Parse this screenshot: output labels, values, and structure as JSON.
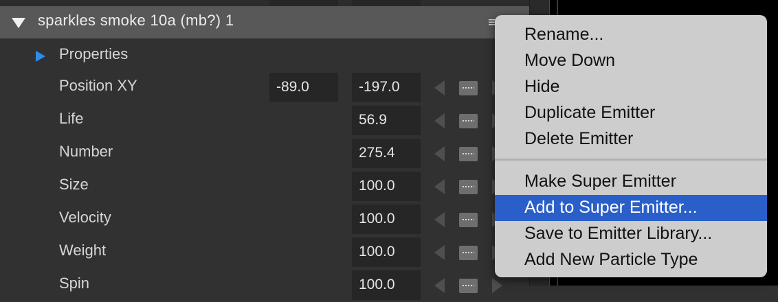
{
  "panel": {
    "title": "sparkles smoke 10a (mb?) 1",
    "menu_glyph": "≡",
    "section_label": "Properties"
  },
  "rows": [
    {
      "label": "Position XY",
      "x": "-89.0",
      "y": "-197.0"
    },
    {
      "label": "Life",
      "y": "56.9"
    },
    {
      "label": "Number",
      "y": "275.4"
    },
    {
      "label": "Size",
      "y": "100.0"
    },
    {
      "label": "Velocity",
      "y": "100.0"
    },
    {
      "label": "Weight",
      "y": "100.0"
    },
    {
      "label": "Spin",
      "y": "100.0"
    }
  ],
  "context_menu": {
    "items": [
      "Rename...",
      "Move Down",
      "Hide",
      "Duplicate Emitter",
      "Delete Emitter",
      "Make Super Emitter",
      "Add to Super Emitter...",
      "Save to Emitter Library...",
      "Add New Particle Type"
    ],
    "highlighted": "Add to Super Emitter..."
  },
  "colors": {
    "highlight": "#2a5fca",
    "expand_arrow": "#2d8ceb"
  }
}
